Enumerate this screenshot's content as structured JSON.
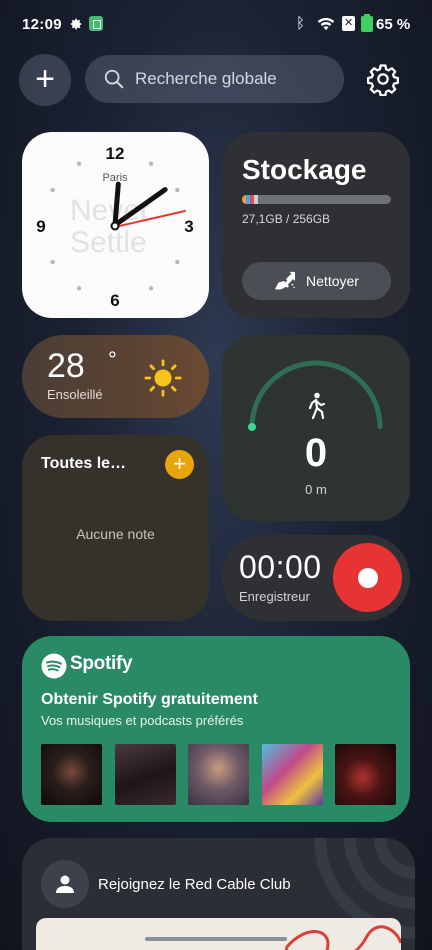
{
  "status_bar": {
    "time": "12:09",
    "battery_percent": "65 %",
    "icons": [
      "gear-icon",
      "app-notification-icon",
      "bluetooth-icon",
      "wifi-icon",
      "sim-off-icon",
      "battery-charging-icon"
    ]
  },
  "top_bar": {
    "add_label": "+",
    "search_placeholder": "Recherche globale"
  },
  "clock_widget": {
    "numerals": [
      "12",
      "3",
      "6",
      "9"
    ],
    "city": "Paris",
    "watermark": "Never Settle",
    "hour": 12,
    "minute": 9
  },
  "storage_widget": {
    "title": "Stockage",
    "usage": "27,1GB / 256GB",
    "used_fraction": 0.106,
    "segment_colors": [
      "#f0a030",
      "#4aa3f0",
      "#e05050",
      "#d0d0d0"
    ],
    "clean_label": "Nettoyer"
  },
  "weather_widget": {
    "temperature": "28",
    "degree": "°",
    "condition": "Ensoleillé",
    "icon": "sun-icon"
  },
  "steps_widget": {
    "icon": "walking-icon",
    "steps": "0",
    "distance": "0 m"
  },
  "notes_widget": {
    "title": "Toutes le…",
    "empty_text": "Aucune note",
    "add_label": "+"
  },
  "recorder_widget": {
    "time": "00:00",
    "label": "Enregistreur"
  },
  "spotify_widget": {
    "brand": "Spotify",
    "title": "Obtenir Spotify gratuitement",
    "subtitle": "Vos musiques et podcasts préférés",
    "album_colors": [
      "#2a1e1c",
      "#3a2a2e",
      "#6d5a66",
      "#c04a8a",
      "#2a1012"
    ]
  },
  "club_widget": {
    "text": "Rejoignez le Red Cable Club"
  },
  "colors": {
    "accent_orange": "#e8a50a",
    "record_red": "#e63434",
    "spotify_green": "#2a8a66",
    "steps_arc": "#2f6e55"
  }
}
